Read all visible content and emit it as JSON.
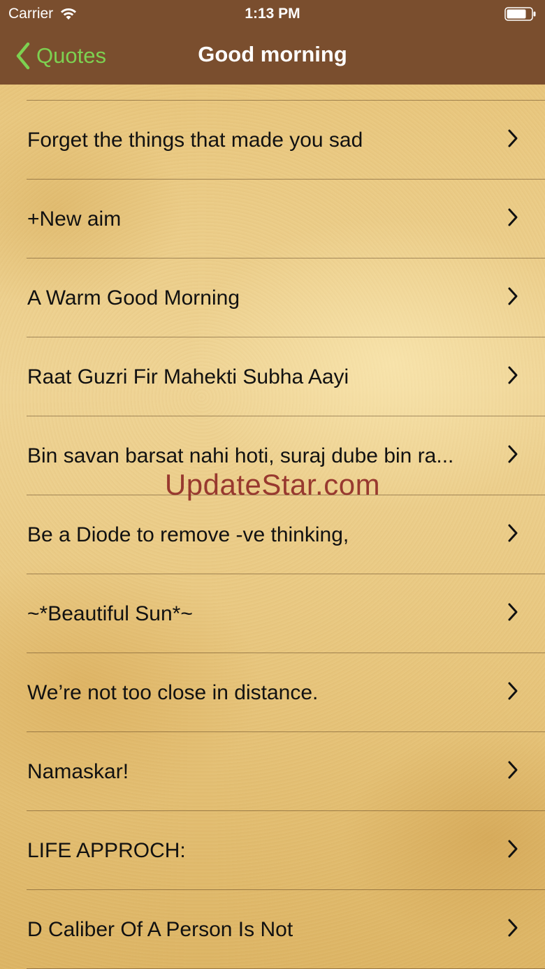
{
  "status_bar": {
    "carrier": "Carrier",
    "time": "1:13 PM",
    "wifi_icon": "wifi-icon",
    "battery_icon": "battery-icon"
  },
  "nav": {
    "back_label": "Quotes",
    "back_icon": "chevron-left-icon",
    "title": "Good morning",
    "accent_color": "#7dd151",
    "bar_color": "#7a4e2e"
  },
  "list": {
    "items": [
      {
        "label": "Forget the things that made you sad"
      },
      {
        "label": "+New aim"
      },
      {
        "label": "A Warm Good Morning"
      },
      {
        "label": "Raat Guzri Fir Mahekti Subha Aayi"
      },
      {
        "label": "Bin savan barsat nahi hoti, suraj dube bin ra..."
      },
      {
        "label": "Be a Diode to remove -ve thinking,"
      },
      {
        "label": "~*Beautiful Sun*~"
      },
      {
        "label": "We’re not too close in distance."
      },
      {
        "label": "Namaskar!"
      },
      {
        "label": "LIFE APPROCH:"
      },
      {
        "label": "D Caliber Of A Person Is Not"
      }
    ],
    "row_icon": "chevron-right-icon"
  },
  "watermark": "UpdateStar.com"
}
